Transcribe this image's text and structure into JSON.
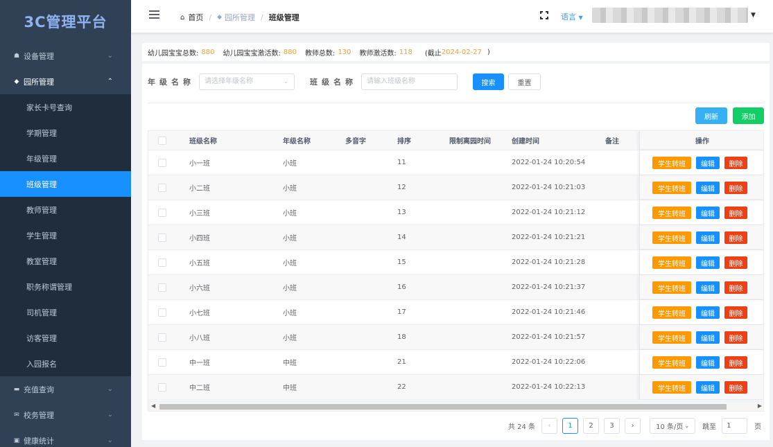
{
  "app": {
    "title": "3C管理平台"
  },
  "sidebar": {
    "items": [
      {
        "label": "设备管理",
        "icon": "device-icon",
        "expanded": false
      },
      {
        "label": "园所管理",
        "icon": "school-icon",
        "expanded": true,
        "children": [
          "家长卡号查询",
          "学期管理",
          "年级管理",
          "班级管理",
          "教师管理",
          "学生管理",
          "教室管理",
          "职务称谓管理",
          "司机管理",
          "访客管理",
          "入园报名"
        ],
        "active_child": "班级管理"
      },
      {
        "label": "充值查询",
        "icon": "card-icon",
        "expanded": false
      },
      {
        "label": "校务管理",
        "icon": "mail-icon",
        "expanded": false
      },
      {
        "label": "健康统计",
        "icon": "health-icon",
        "expanded": false
      }
    ]
  },
  "header": {
    "breadcrumb": [
      "首页",
      "园所管理",
      "班级管理"
    ],
    "language_label": "语言"
  },
  "stats": {
    "baby_total_label": "幼儿园宝宝总数:",
    "baby_total": "880",
    "baby_active_label": "幼儿园宝宝激活数:",
    "baby_active": "880",
    "teacher_total_label": "教师总数:",
    "teacher_total": "130",
    "teacher_active_label": "教师激活数:",
    "teacher_active": "118",
    "cutoff_prefix": "(截止",
    "cutoff_date": "2024-02-27",
    "cutoff_suffix": ")"
  },
  "filter": {
    "grade_label": "年级名称",
    "grade_placeholder": "请选择年级名称",
    "class_label": "班级名称",
    "class_placeholder": "请输入班级名称",
    "search_label": "搜索",
    "reset_label": "重置"
  },
  "actions": {
    "refresh_label": "刷新",
    "add_label": "添加"
  },
  "table": {
    "columns": [
      "班级名称",
      "年级名称",
      "多音字",
      "排序",
      "限制离园时间",
      "创建时间",
      "备注",
      "操作"
    ],
    "row_actions": {
      "transfer": "学生转班",
      "edit": "编辑",
      "delete": "删除"
    },
    "rows": [
      {
        "name": "小一班",
        "grade": "小班",
        "polyphone": "",
        "sort": "11",
        "limit_time": "",
        "created": "2022-01-24 10:20:54",
        "remark": ""
      },
      {
        "name": "小二班",
        "grade": "小班",
        "polyphone": "",
        "sort": "12",
        "limit_time": "",
        "created": "2022-01-24 10:21:03",
        "remark": ""
      },
      {
        "name": "小三班",
        "grade": "小班",
        "polyphone": "",
        "sort": "13",
        "limit_time": "",
        "created": "2022-01-24 10:21:12",
        "remark": ""
      },
      {
        "name": "小四班",
        "grade": "小班",
        "polyphone": "",
        "sort": "14",
        "limit_time": "",
        "created": "2022-01-24 10:21:21",
        "remark": ""
      },
      {
        "name": "小五班",
        "grade": "小班",
        "polyphone": "",
        "sort": "15",
        "limit_time": "",
        "created": "2022-01-24 10:21:28",
        "remark": ""
      },
      {
        "name": "小六班",
        "grade": "小班",
        "polyphone": "",
        "sort": "16",
        "limit_time": "",
        "created": "2022-01-24 10:21:37",
        "remark": ""
      },
      {
        "name": "小七班",
        "grade": "小班",
        "polyphone": "",
        "sort": "17",
        "limit_time": "",
        "created": "2022-01-24 10:21:46",
        "remark": ""
      },
      {
        "name": "小八班",
        "grade": "小班",
        "polyphone": "",
        "sort": "18",
        "limit_time": "",
        "created": "2022-01-24 10:21:57",
        "remark": ""
      },
      {
        "name": "中一班",
        "grade": "中班",
        "polyphone": "",
        "sort": "21",
        "limit_time": "",
        "created": "2022-01-24 10:22:06",
        "remark": ""
      },
      {
        "name": "中二班",
        "grade": "中班",
        "polyphone": "",
        "sort": "22",
        "limit_time": "",
        "created": "2022-01-24 10:22:13",
        "remark": ""
      }
    ]
  },
  "pagination": {
    "total_text": "共 24 条",
    "pages": [
      "1",
      "2",
      "3"
    ],
    "current_page": "1",
    "page_size_text": "10 条/页",
    "jump_label": "跳至",
    "jump_value": "1",
    "page_unit": "页"
  }
}
